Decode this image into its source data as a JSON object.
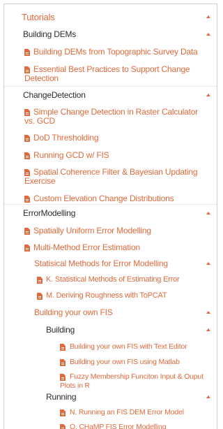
{
  "colors": {
    "accent": "#e06a3c",
    "folder_dark": "#2b2b2b",
    "text_dark": "#2b2b2b"
  },
  "tree": {
    "root": {
      "label": "Tutorials",
      "icon": "folder-open-icon"
    },
    "building_dems": {
      "label": "Building DEMs",
      "items": [
        "Building DEMs from Topographic Survey Data",
        "Essential Best Practices to Support Change Detection"
      ]
    },
    "change_detection": {
      "label": "ChangeDetection",
      "items": [
        "Simple Change Detection in Raster Calculator vs. GCD",
        "DoD Thresholding",
        "Running GCD w/ FIS",
        "Spatial Coherence Filter & Bayesian Updating Exercise",
        "Custom Elevation Change Distributions"
      ]
    },
    "error_modelling": {
      "label": "ErrorModelling",
      "items": [
        "Spatially Uniform Error Modelling",
        "Multi-Method Error Estimation"
      ],
      "stat_methods": {
        "label": "Statisical Methods for Error Modelling",
        "items": [
          "K. Statistical Methods of Estimating Error",
          "M. Deriving Roughness with ToPCAT"
        ]
      },
      "own_fis": {
        "label": "Building your own FIS",
        "building": {
          "label": "Building",
          "items": [
            "Building your own FIS with Text Editor",
            "Building your own FIS using Matlab",
            "Fuzzy Membership Funciton Input & Ouput Plots in R"
          ]
        },
        "running": {
          "label": "Running",
          "items": [
            "N. Running an FIS DEM Error Model",
            "O. CHaMP FIS Error Modelling"
          ]
        }
      }
    }
  }
}
